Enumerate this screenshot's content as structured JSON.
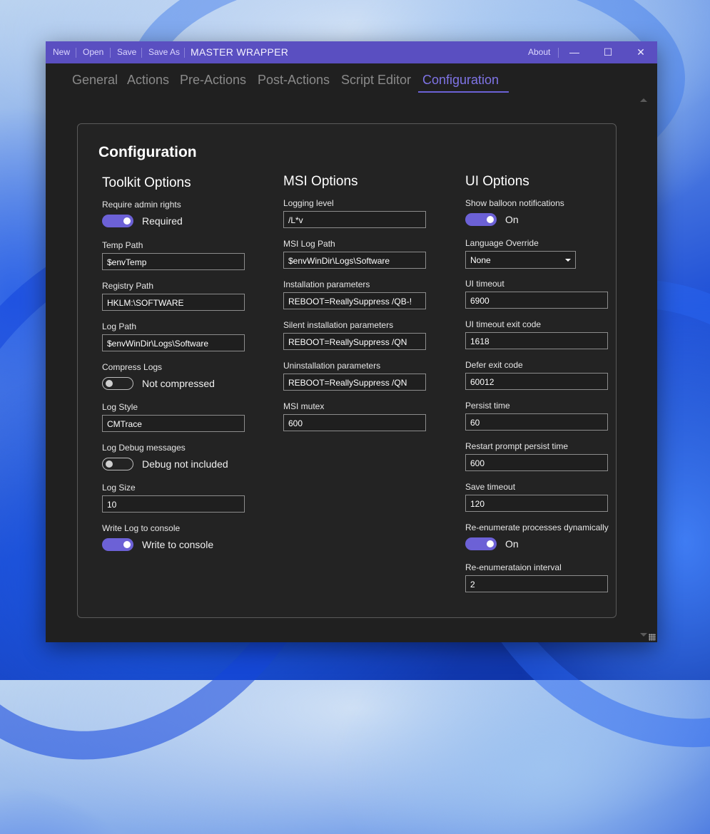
{
  "titlebar": {
    "menu": [
      "New",
      "Open",
      "Save",
      "Save As"
    ],
    "app_title": "MASTER WRAPPER",
    "about": "About"
  },
  "tabs": [
    "General",
    "Actions",
    "Pre-Actions",
    "Post-Actions",
    "Script Editor",
    "Configuration"
  ],
  "active_tab": "Configuration",
  "panel_title": "Configuration",
  "toolkit": {
    "title": "Toolkit Options",
    "require_admin_label": "Require admin rights",
    "require_admin_state": "Required",
    "temp_path_label": "Temp Path",
    "temp_path": "$envTemp",
    "registry_path_label": "Registry Path",
    "registry_path": "HKLM:\\SOFTWARE",
    "log_path_label": "Log Path",
    "log_path": "$envWinDir\\Logs\\Software",
    "compress_logs_label": "Compress Logs",
    "compress_logs_state": "Not compressed",
    "log_style_label": "Log Style",
    "log_style": "CMTrace",
    "log_debug_label": "Log Debug messages",
    "log_debug_state": "Debug not included",
    "log_size_label": "Log Size",
    "log_size": "10",
    "write_console_label": "Write Log to console",
    "write_console_state": "Write to console"
  },
  "msi": {
    "title": "MSI Options",
    "logging_level_label": "Logging level",
    "logging_level": "/L*v",
    "log_path_label": "MSI Log Path",
    "log_path": "$envWinDir\\Logs\\Software",
    "install_params_label": "Installation parameters",
    "install_params": "REBOOT=ReallySuppress /QB-!",
    "silent_params_label": "Silent installation parameters",
    "silent_params": "REBOOT=ReallySuppress /QN",
    "uninstall_params_label": "Uninstallation parameters",
    "uninstall_params": "REBOOT=ReallySuppress /QN",
    "mutex_label": "MSI mutex",
    "mutex": "600"
  },
  "ui": {
    "title": "UI Options",
    "balloon_label": "Show balloon notifications",
    "balloon_state": "On",
    "language_label": "Language Override",
    "language": "None",
    "ui_timeout_label": "UI timeout",
    "ui_timeout": "6900",
    "ui_timeout_exit_label": "UI timeout exit code",
    "ui_timeout_exit": "1618",
    "defer_exit_label": "Defer exit code",
    "defer_exit": "60012",
    "persist_time_label": "Persist time",
    "persist_time": "60",
    "restart_persist_label": "Restart prompt persist time",
    "restart_persist": "600",
    "save_timeout_label": "Save timeout",
    "save_timeout": "120",
    "reenum_label": "Re-enumerate processes dynamically",
    "reenum_state": "On",
    "reenum_interval_label": "Re-enumerataion interval",
    "reenum_interval": "2"
  },
  "colors": {
    "accent": "#5a4fc1",
    "toggle_on": "#6c61d6",
    "active_tab": "#7f74e6",
    "background": "#202020"
  },
  "icons": {
    "minimize": "minimize-icon",
    "maximize": "maximize-icon",
    "close": "close-icon"
  }
}
